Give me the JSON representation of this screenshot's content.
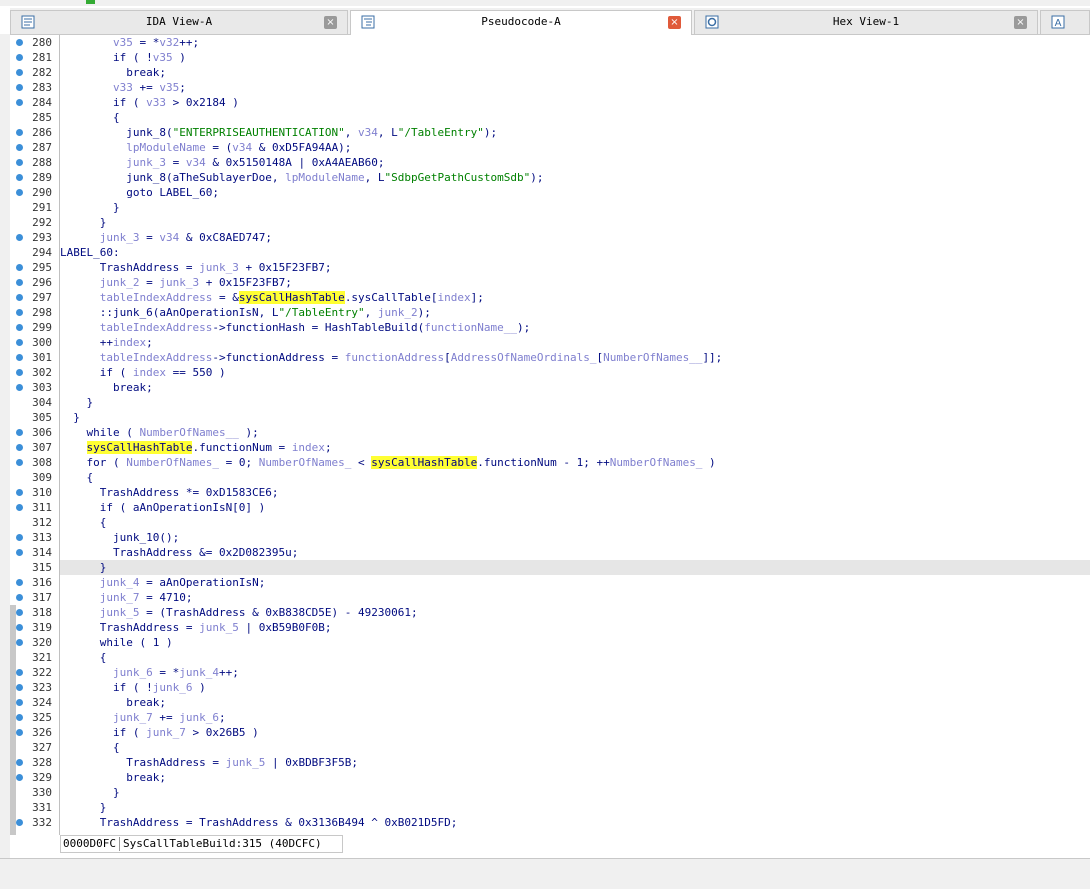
{
  "tabs": [
    {
      "label": "IDA View-A",
      "icon": "ida-view-icon",
      "close": "close-icon",
      "active": false
    },
    {
      "label": "Pseudocode-A",
      "icon": "pseudocode-icon",
      "close": "close-icon",
      "active": true
    },
    {
      "label": "Hex View-1",
      "icon": "hex-view-icon",
      "close": "close-icon",
      "active": false
    },
    {
      "label": "",
      "icon": "structures-icon",
      "close": "",
      "active": false
    }
  ],
  "code_lines": [
    {
      "no": "280",
      "bp": true,
      "html": "        <span class='v'>v35</span> = *<span class='v'>v32</span>++;"
    },
    {
      "no": "281",
      "bp": true,
      "html": "        if ( !<span class='v'>v35</span> )"
    },
    {
      "no": "282",
      "bp": true,
      "html": "          break;"
    },
    {
      "no": "283",
      "bp": true,
      "html": "        <span class='v'>v33</span> += <span class='v'>v35</span>;"
    },
    {
      "no": "284",
      "bp": true,
      "html": "        if ( <span class='v'>v33</span> &gt; 0x2184 )"
    },
    {
      "no": "285",
      "bp": false,
      "html": "        {"
    },
    {
      "no": "286",
      "bp": true,
      "html": "          junk_8(<span class='s'>\"ENTERPRISEAUTHENTICATION\"</span>, <span class='v'>v34</span>, L<span class='s'>\"/TableEntry\"</span>);"
    },
    {
      "no": "287",
      "bp": true,
      "html": "          <span class='v'>lpModuleName</span> = (<span class='v'>v34</span> &amp; 0xD5FA94AA);"
    },
    {
      "no": "288",
      "bp": true,
      "html": "          <span class='v'>junk_3</span> = <span class='v'>v34</span> &amp; 0x5150148A | 0xA4AEAB60;"
    },
    {
      "no": "289",
      "bp": true,
      "html": "          junk_8(aTheSublayerDoe, <span class='v'>lpModuleName</span>, L<span class='s'>\"SdbpGetPathCustomSdb\"</span>);"
    },
    {
      "no": "290",
      "bp": true,
      "html": "          goto LABEL_60;"
    },
    {
      "no": "291",
      "bp": false,
      "html": "        }"
    },
    {
      "no": "292",
      "bp": false,
      "html": "      }"
    },
    {
      "no": "293",
      "bp": true,
      "html": "      <span class='v'>junk_3</span> = <span class='v'>v34</span> &amp; 0xC8AED747;"
    },
    {
      "no": "294",
      "bp": false,
      "html": "LABEL_60:"
    },
    {
      "no": "295",
      "bp": true,
      "html": "      TrashAddress = <span class='v'>junk_3</span> + 0x15F23FB7;"
    },
    {
      "no": "296",
      "bp": true,
      "html": "      <span class='v'>junk_2</span> = <span class='v'>junk_3</span> + 0x15F23FB7;"
    },
    {
      "no": "297",
      "bp": true,
      "html": "      <span class='v'>tableIndexAddress</span> = &amp;<span class='y'>sysCallHashTable</span>.sysCallTable[<span class='v'>index</span>];"
    },
    {
      "no": "298",
      "bp": true,
      "html": "      ::junk_6(aAnOperationIsN, L<span class='s'>\"/TableEntry\"</span>, <span class='v'>junk_2</span>);"
    },
    {
      "no": "299",
      "bp": true,
      "html": "      <span class='v'>tableIndexAddress</span>-&gt;functionHash = HashTableBuild(<span class='v'>functionName__</span>);"
    },
    {
      "no": "300",
      "bp": true,
      "html": "      ++<span class='v'>index</span>;"
    },
    {
      "no": "301",
      "bp": true,
      "html": "      <span class='v'>tableIndexAddress</span>-&gt;functionAddress = <span class='v'>functionAddress</span>[<span class='v'>AddressOfNameOrdinals_</span>[<span class='v'>NumberOfNames__</span>]];"
    },
    {
      "no": "302",
      "bp": true,
      "html": "      if ( <span class='v'>index</span> == 550 )"
    },
    {
      "no": "303",
      "bp": true,
      "html": "        break;"
    },
    {
      "no": "304",
      "bp": false,
      "html": "    }"
    },
    {
      "no": "305",
      "bp": false,
      "html": "  }"
    },
    {
      "no": "306",
      "bp": true,
      "html": "    while ( <span class='v'>NumberOfNames__</span> );"
    },
    {
      "no": "307",
      "bp": true,
      "html": "    <span class='y'>sysCallHashTable</span>.functionNum = <span class='v'>index</span>;"
    },
    {
      "no": "308",
      "bp": true,
      "html": "    for ( <span class='v'>NumberOfNames_</span> = 0; <span class='v'>NumberOfNames_</span> &lt; <span class='y'>sysCallHashTable</span>.functionNum - 1; ++<span class='v'>NumberOfNames_</span> )"
    },
    {
      "no": "309",
      "bp": false,
      "html": "    {"
    },
    {
      "no": "310",
      "bp": true,
      "html": "      TrashAddress *= 0xD1583CE6;"
    },
    {
      "no": "311",
      "bp": true,
      "html": "      if ( aAnOperationIsN[0] )"
    },
    {
      "no": "312",
      "bp": false,
      "html": "      {"
    },
    {
      "no": "313",
      "bp": true,
      "html": "        junk_10();"
    },
    {
      "no": "314",
      "bp": true,
      "html": "        TrashAddress &amp;= 0x2D082395u;"
    },
    {
      "no": "315",
      "bp": false,
      "hl": true,
      "html": "      }"
    },
    {
      "no": "316",
      "bp": true,
      "html": "      <span class='v'>junk_4</span> = aAnOperationIsN;"
    },
    {
      "no": "317",
      "bp": true,
      "html": "      <span class='v'>junk_7</span> = 4710;"
    },
    {
      "no": "318",
      "bp": true,
      "html": "      <span class='v'>junk_5</span> = (TrashAddress &amp; 0xB838CD5E) - 49230061;"
    },
    {
      "no": "319",
      "bp": true,
      "html": "      TrashAddress = <span class='v'>junk_5</span> | 0xB59B0F0B;"
    },
    {
      "no": "320",
      "bp": true,
      "html": "      while ( 1 )"
    },
    {
      "no": "321",
      "bp": false,
      "html": "      {"
    },
    {
      "no": "322",
      "bp": true,
      "html": "        <span class='v'>junk_6</span> = *<span class='v'>junk_4</span>++;"
    },
    {
      "no": "323",
      "bp": true,
      "html": "        if ( !<span class='v'>junk_6</span> )"
    },
    {
      "no": "324",
      "bp": true,
      "html": "          break;"
    },
    {
      "no": "325",
      "bp": true,
      "html": "        <span class='v'>junk_7</span> += <span class='v'>junk_6</span>;"
    },
    {
      "no": "326",
      "bp": true,
      "html": "        if ( <span class='v'>junk_7</span> &gt; 0x26B5 )"
    },
    {
      "no": "327",
      "bp": false,
      "html": "        {"
    },
    {
      "no": "328",
      "bp": true,
      "html": "          TrashAddress = <span class='v'>junk_5</span> | 0xBDBF3F5B;"
    },
    {
      "no": "329",
      "bp": true,
      "html": "          break;"
    },
    {
      "no": "330",
      "bp": false,
      "html": "        }"
    },
    {
      "no": "331",
      "bp": false,
      "html": "      }"
    },
    {
      "no": "332",
      "bp": true,
      "html": "      TrashAddress = TrashAddress &amp; 0x3136B494 ^ 0xB021D5FD;"
    }
  ],
  "status": {
    "address": "0000D0FC",
    "location": "SysCallTableBuild:315 (40DCFC)"
  },
  "colors": {
    "breakpoint": "#3c8fd8",
    "highlight": "#ffff33",
    "close_active": "#e05a3a",
    "close_inactive": "#9a9a9a",
    "current_line": "#e6e6e6"
  }
}
